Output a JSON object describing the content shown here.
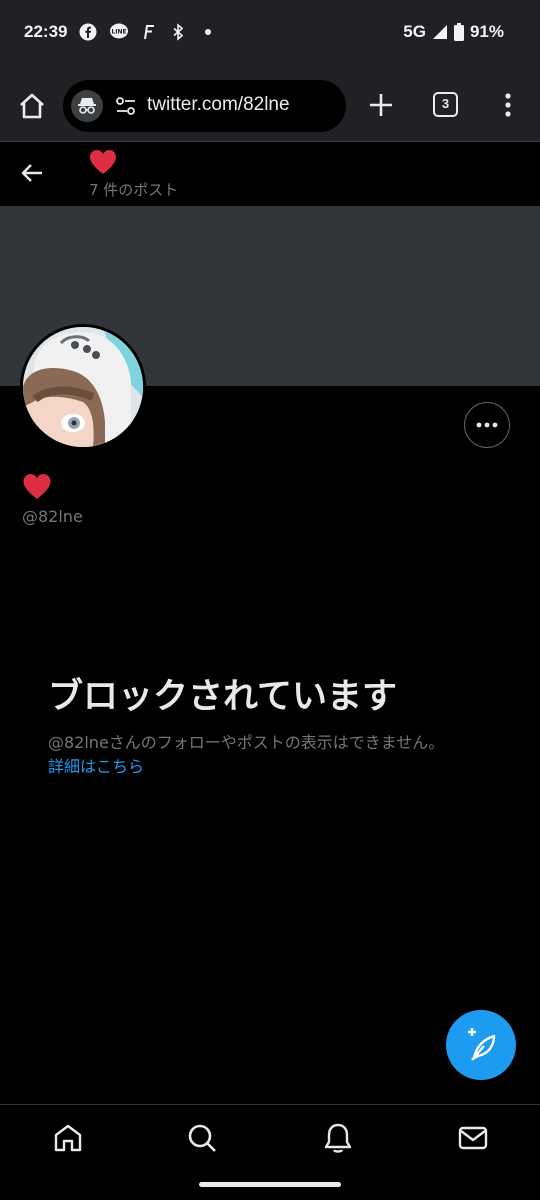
{
  "status_bar": {
    "time": "22:39",
    "network": "5G",
    "battery": "91%",
    "icons": [
      "facebook-icon",
      "line-icon",
      "f-app-icon",
      "bluetooth-icon",
      "dot-icon",
      "signal-icon",
      "battery-icon"
    ]
  },
  "browser": {
    "url": "twitter.com/82lne",
    "tab_count": "3",
    "icons": [
      "home-icon",
      "incognito-icon",
      "site-settings-icon",
      "new-tab-icon",
      "more-vert-icon"
    ]
  },
  "profile": {
    "post_count": "7 件のポスト",
    "handle": "@82lne",
    "display_name_emoji": "❤️"
  },
  "blocked": {
    "title": "ブロックされています",
    "description": "@82lneさんのフォローやポストの表示はできません。",
    "learn_more": "詳細はこちら"
  },
  "bottom_nav": [
    "home-icon",
    "search-icon",
    "notifications-icon",
    "messages-icon"
  ],
  "colors": {
    "accent": "#1d9bf0",
    "heart": "#e0245e",
    "banner": "#333639",
    "secondary_text": "#71767b"
  }
}
